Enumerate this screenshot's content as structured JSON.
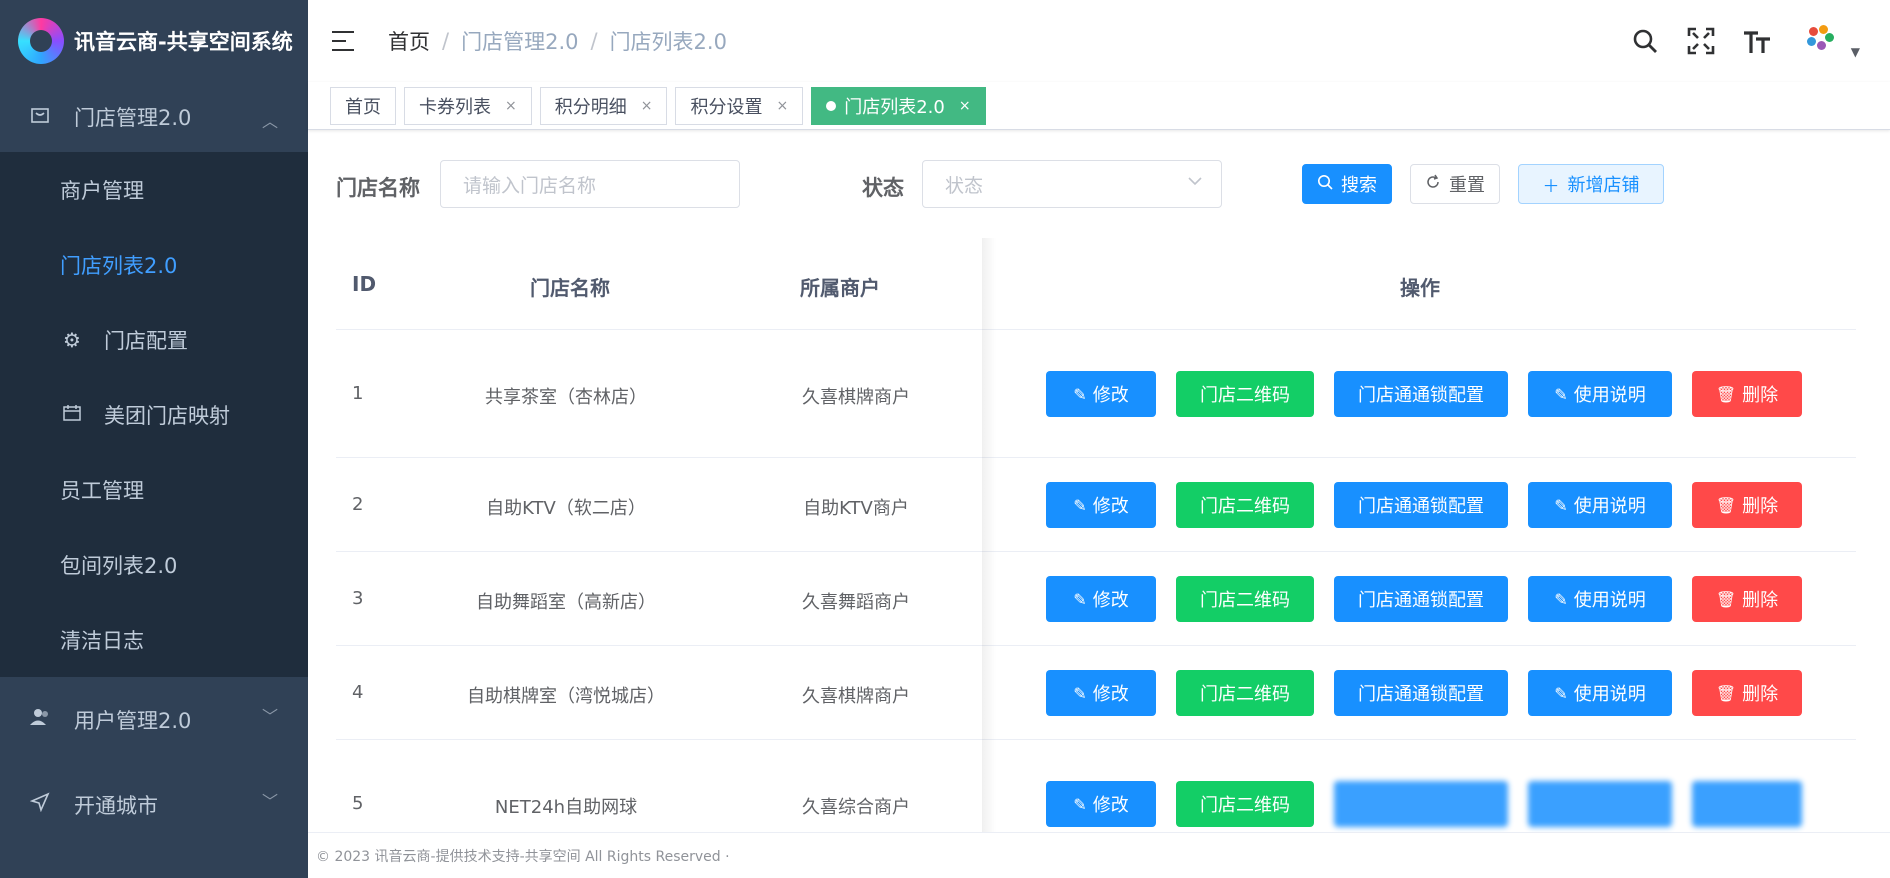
{
  "app": {
    "title": "讯音云商-共享空间系统"
  },
  "sidebar": {
    "groups": [
      {
        "label": "门店管理2.0",
        "icon": "store-icon",
        "expanded": true,
        "items": [
          {
            "label": "商户管理",
            "active": false
          },
          {
            "label": "门店列表2.0",
            "active": true
          },
          {
            "label": "门店配置",
            "icon": "gear-icon",
            "active": false
          },
          {
            "label": "美团门店映射",
            "icon": "calendar-icon",
            "active": false
          },
          {
            "label": "员工管理",
            "active": false
          },
          {
            "label": "包间列表2.0",
            "active": false
          },
          {
            "label": "清洁日志",
            "active": false
          }
        ]
      },
      {
        "label": "用户管理2.0",
        "icon": "user-icon",
        "expanded": false
      },
      {
        "label": "开通城市",
        "icon": "send-icon",
        "expanded": false
      }
    ]
  },
  "header": {
    "breadcrumb": [
      "首页",
      "门店管理2.0",
      "门店列表2.0"
    ],
    "separator": "/",
    "tools": [
      "search-icon",
      "fullscreen-icon",
      "font-size-icon"
    ]
  },
  "tags": [
    {
      "label": "首页",
      "closable": false,
      "active": false
    },
    {
      "label": "卡券列表",
      "closable": true,
      "active": false
    },
    {
      "label": "积分明细",
      "closable": true,
      "active": false
    },
    {
      "label": "积分设置",
      "closable": true,
      "active": false
    },
    {
      "label": "门店列表2.0",
      "closable": true,
      "active": true
    }
  ],
  "filters": {
    "store_name_label": "门店名称",
    "store_name_placeholder": "请输入门店名称",
    "status_label": "状态",
    "status_placeholder": "状态",
    "search_button": "搜索",
    "reset_button": "重置",
    "add_button": "新增店铺"
  },
  "table": {
    "columns": [
      "ID",
      "门店名称",
      "所属商户",
      "操作"
    ],
    "rows": [
      {
        "id": "1",
        "name": "共享茶室（杏林店）",
        "merchant": "久喜棋牌商户"
      },
      {
        "id": "2",
        "name": "自助KTV（软二店）",
        "merchant": "自助KTV商户"
      },
      {
        "id": "3",
        "name": "自助舞蹈室（高新店）",
        "merchant": "久喜舞蹈商户"
      },
      {
        "id": "4",
        "name": "自助棋牌室（湾悦城店）",
        "merchant": "久喜棋牌商户"
      },
      {
        "id": "5",
        "name": "NET24h自助网球",
        "merchant": "久喜综合商户"
      }
    ],
    "actions": {
      "edit": "修改",
      "qrcode": "门店二维码",
      "lock_config": "门店通通锁配置",
      "instructions": "使用说明",
      "delete": "删除"
    }
  },
  "footer": {
    "text": "© 2023 讯音云商-提供技术支持-共享空间 All Rights Reserved ·"
  },
  "colors": {
    "sidebar_bg": "#304156",
    "submenu_bg": "#1f2d3d",
    "active_menu": "#409eff",
    "primary": "#1890ff",
    "success": "#13ce66",
    "danger": "#ff4949",
    "active_tag": "#42b983"
  }
}
